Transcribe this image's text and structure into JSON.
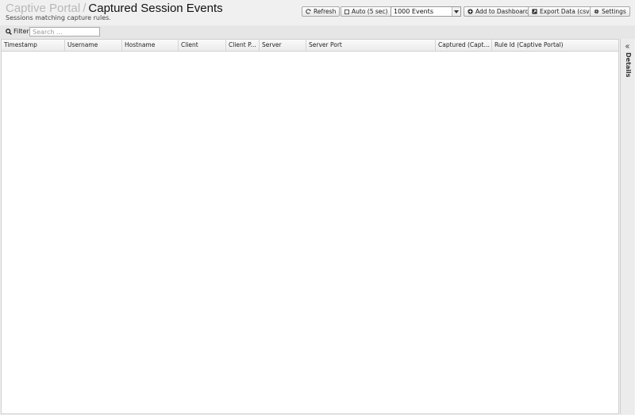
{
  "header": {
    "breadcrumb_parent": "Captive Portal",
    "breadcrumb_separator": "/",
    "title": "Captured Session Events",
    "subtitle": "Sessions matching capture rules."
  },
  "toolbar": {
    "refresh_label": "Refresh",
    "auto_label": "Auto (5 sec)",
    "auto_checked": false,
    "events_select_value": "1000 Events",
    "add_dashboard_label": "Add to Dashboard",
    "export_label": "Export Data (csv)",
    "settings_label": "Settings"
  },
  "filter": {
    "label": "Filter",
    "placeholder": "Search ...",
    "value": ""
  },
  "grid": {
    "columns": [
      "Timestamp",
      "Username",
      "Hostname",
      "Client",
      "Client P...",
      "Server",
      "Server Port",
      "Captured (Captiv...",
      "Rule Id (Captive Portal)"
    ],
    "rows": []
  },
  "side_panel": {
    "label": "Details"
  },
  "icons": {
    "refresh": "refresh-icon",
    "add_dashboard": "plus-circle-icon",
    "export": "export-icon",
    "settings": "gear-icon",
    "search": "search-icon",
    "collapse": "chevron-left-icon"
  }
}
